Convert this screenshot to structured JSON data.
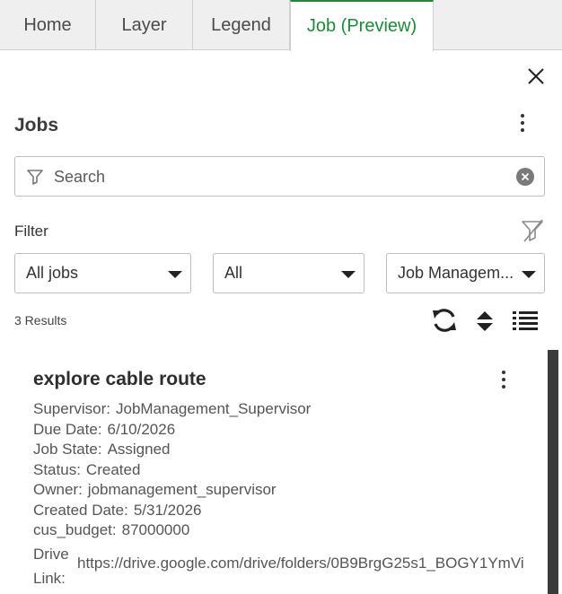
{
  "tabs": [
    {
      "label": "Home"
    },
    {
      "label": "Layer"
    },
    {
      "label": "Legend"
    },
    {
      "label": "Job (Preview)",
      "active": true
    }
  ],
  "panel": {
    "title": "Jobs"
  },
  "search": {
    "placeholder": "Search",
    "value": ""
  },
  "filter": {
    "label": "Filter",
    "selects": [
      {
        "value": "All jobs"
      },
      {
        "value": "All"
      },
      {
        "value": "Job Managem..."
      }
    ]
  },
  "results": {
    "count_text": "3 Results"
  },
  "job": {
    "title": "explore cable route",
    "fields": [
      {
        "key": "Supervisor:",
        "value": "JobManagement_Supervisor"
      },
      {
        "key": "Due Date:",
        "value": "6/10/2026"
      },
      {
        "key": "Job State:",
        "value": "Assigned"
      },
      {
        "key": "Status:",
        "value": "Created"
      },
      {
        "key": "Owner:",
        "value": "jobmanagement_supervisor"
      },
      {
        "key": "Created Date:",
        "value": "5/31/2026"
      },
      {
        "key": "cus_budget:",
        "value": "87000000"
      }
    ],
    "drive_link_label": "Drive Link:",
    "drive_link_value": "https://drive.google.com/drive/folders/0B9BrgG25s1_BOGY1YmVi"
  },
  "colors": {
    "accent": "#1f8a3b",
    "tab_bg": "#efefef",
    "scrollbar": "#3b3b3b"
  },
  "icons": [
    "close-icon",
    "kebab-menu-icon",
    "filter-funnel-icon",
    "clear-circle-icon",
    "clear-filter-icon",
    "refresh-icon",
    "sort-icon",
    "list-view-icon"
  ]
}
